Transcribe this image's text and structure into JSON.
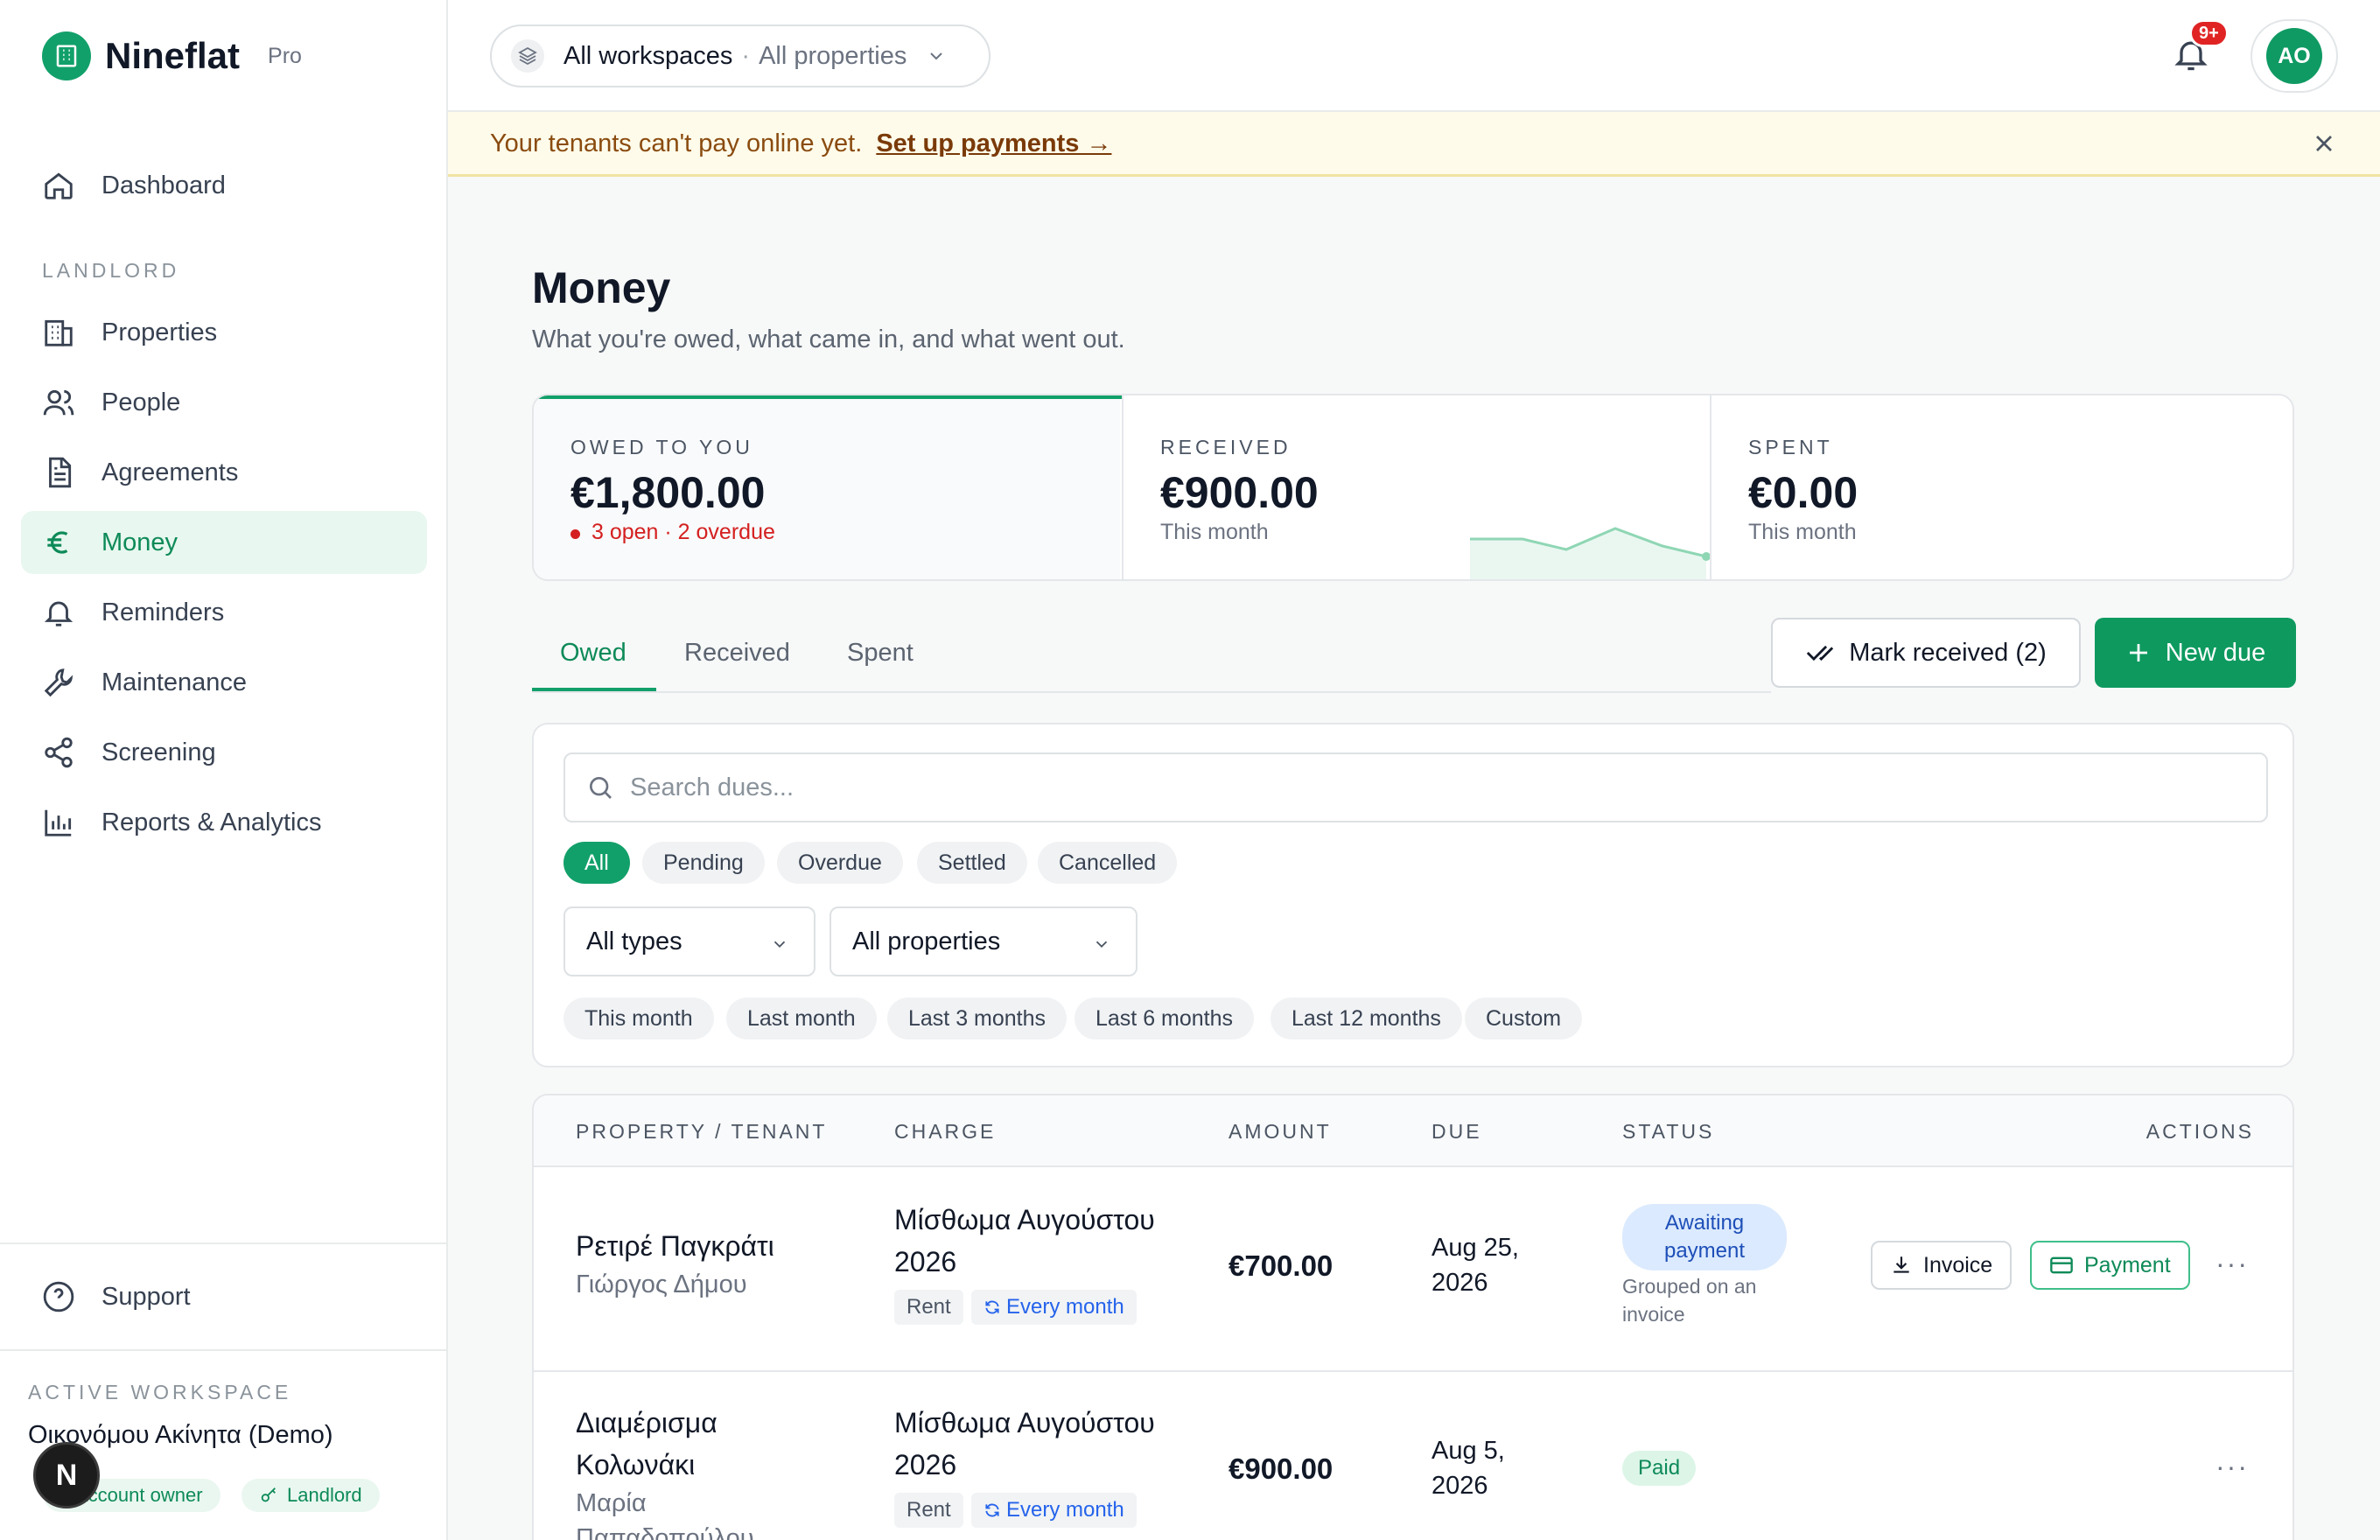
{
  "brand": {
    "name": "Nineflat",
    "plan": "Pro"
  },
  "sidebar": {
    "items": [
      {
        "label": "Dashboard",
        "icon": "home-icon"
      },
      {
        "label": "Properties",
        "icon": "building-icon"
      },
      {
        "label": "People",
        "icon": "users-icon"
      },
      {
        "label": "Agreements",
        "icon": "document-icon"
      },
      {
        "label": "Money",
        "icon": "euro-icon"
      },
      {
        "label": "Reminders",
        "icon": "bell-icon"
      },
      {
        "label": "Maintenance",
        "icon": "wrench-icon"
      },
      {
        "label": "Screening",
        "icon": "share-icon"
      },
      {
        "label": "Reports & Analytics",
        "icon": "bar-chart-icon"
      }
    ],
    "section_label": "LANDLORD",
    "support": "Support",
    "workspace": {
      "label": "ACTIVE WORKSPACE",
      "name": "Οικονόμου Ακίνητα (Demo)",
      "roles": [
        "Account owner",
        "Landlord"
      ]
    },
    "n_badge": "N"
  },
  "topbar": {
    "workspace": "All workspaces",
    "separator": "·",
    "property": "All properties",
    "notification_count": "9+",
    "avatar": "AO"
  },
  "banner": {
    "text": "Your tenants can't pay online yet.",
    "link": "Set up payments →"
  },
  "page": {
    "title": "Money",
    "subtitle": "What you're owed, what came in, and what went out."
  },
  "stats": {
    "owed": {
      "label": "OWED TO YOU",
      "value": "€1,800.00",
      "sub": "3 open · 2 overdue"
    },
    "received": {
      "label": "RECEIVED",
      "value": "€900.00",
      "sub": "This month"
    },
    "spent": {
      "label": "SPENT",
      "value": "€0.00",
      "sub": "This month"
    }
  },
  "tabs": [
    "Owed",
    "Received",
    "Spent"
  ],
  "actions": {
    "mark_received": "Mark received (2)",
    "new_due": "New due"
  },
  "filters": {
    "search_placeholder": "Search dues...",
    "status_chips": [
      "All",
      "Pending",
      "Overdue",
      "Settled",
      "Cancelled"
    ],
    "type_select": "All types",
    "property_select": "All properties",
    "period_chips": [
      "This month",
      "Last month",
      "Last 3 months",
      "Last 6 months",
      "Last 12 months",
      "Custom"
    ]
  },
  "table": {
    "headers": [
      "PROPERTY / TENANT",
      "CHARGE",
      "AMOUNT",
      "DUE",
      "STATUS",
      "ACTIONS"
    ],
    "rows": [
      {
        "property": "Ρετιρέ Παγκράτι",
        "tenant": "Γιώργος Δήμου",
        "charge": "Μίσθωμα Αυγούστου 2026",
        "type": "Rent",
        "recurrence": "Every month",
        "amount": "€700.00",
        "due": "Aug 25, 2026",
        "status": "Awaiting payment",
        "status_note": "Grouped on an invoice",
        "invoice": "Invoice",
        "payment": "Payment",
        "more": "···"
      },
      {
        "property": "Διαμέρισμα Κολωνάκι",
        "tenant": "Μαρία Παπαδοπούλου",
        "charge": "Μίσθωμα Αυγούστου 2026",
        "type": "Rent",
        "recurrence": "Every month",
        "amount": "€900.00",
        "due": "Aug 5, 2026",
        "status": "Paid",
        "more": "···"
      }
    ]
  },
  "colors": {
    "accent": "#12a06a",
    "danger": "#d42020",
    "banner_bg": "#fefbea",
    "info": "#1e4fb8"
  }
}
